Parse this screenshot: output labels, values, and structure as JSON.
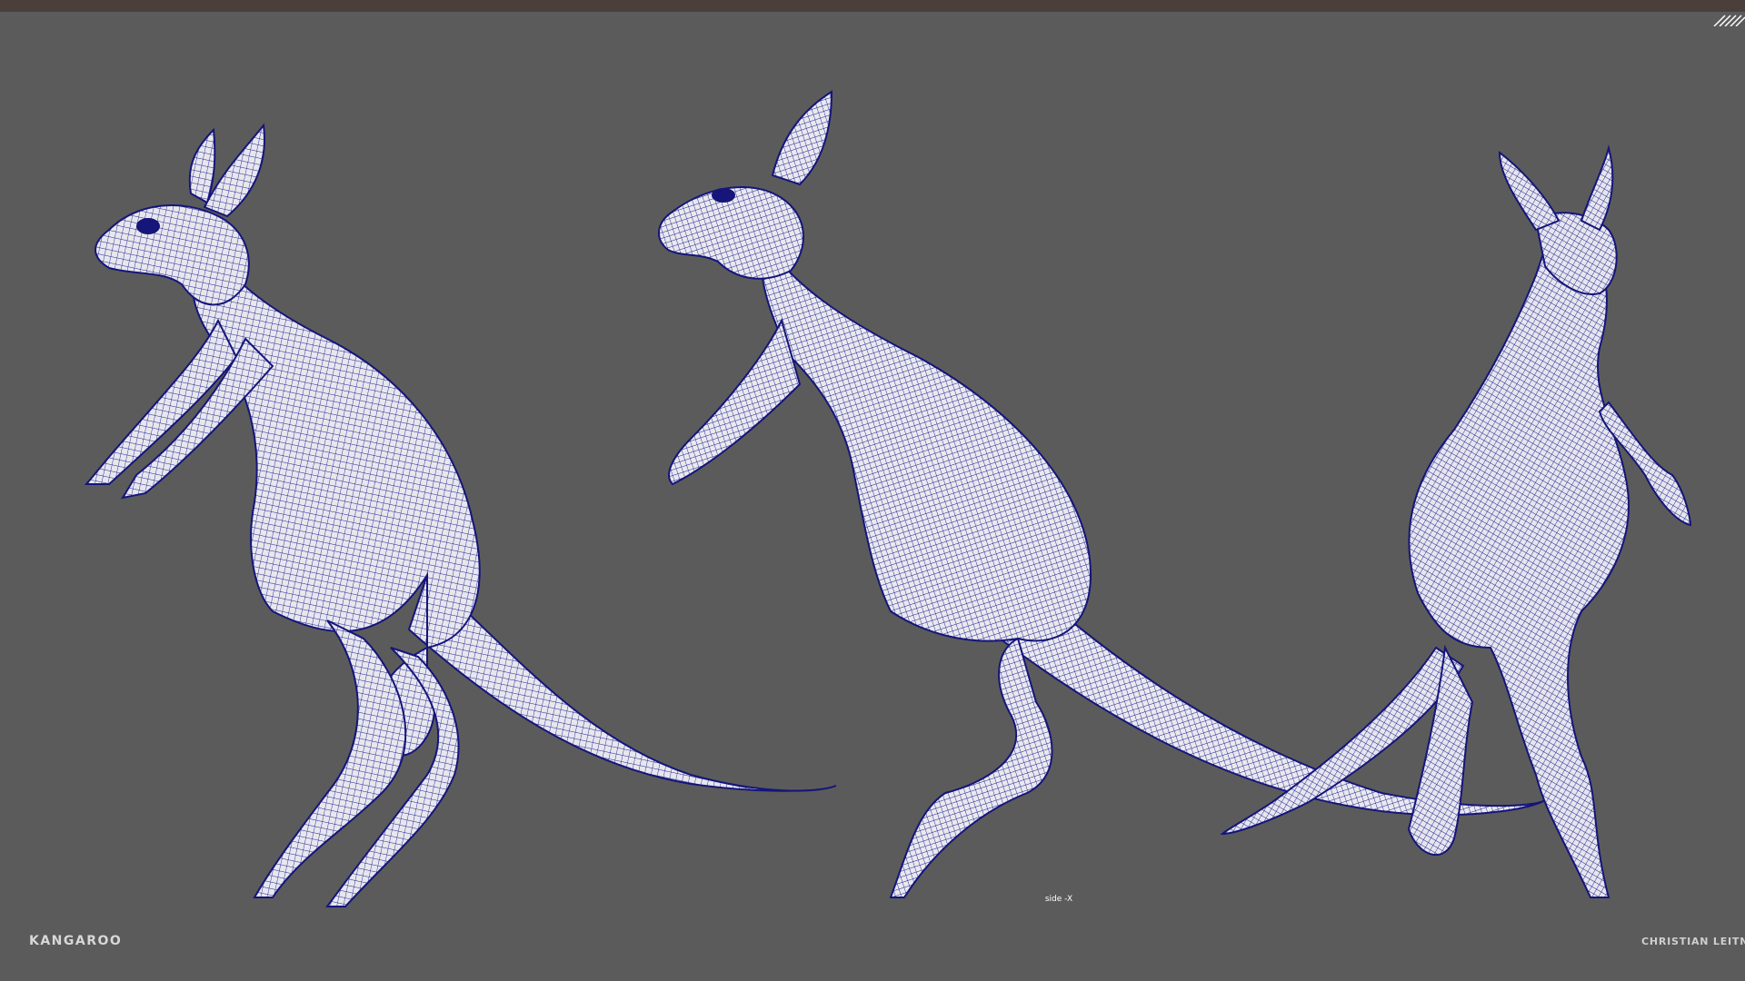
{
  "app": {
    "accent_color": "#1b1b8a",
    "mesh_fill": "#e9e9ee",
    "viewport_bg": "#5b5b5b",
    "topbar_color": "#4a3f3b"
  },
  "viewport": {
    "camera_label": "side -X",
    "models": [
      {
        "name": "kangaroo-left-view"
      },
      {
        "name": "kangaroo-side-view"
      },
      {
        "name": "kangaroo-back-view"
      }
    ]
  },
  "footer": {
    "title": "KANGAROO",
    "author": "CHRISTIAN LEITNE"
  },
  "icons": {
    "corner": "hatched-corner-icon"
  }
}
